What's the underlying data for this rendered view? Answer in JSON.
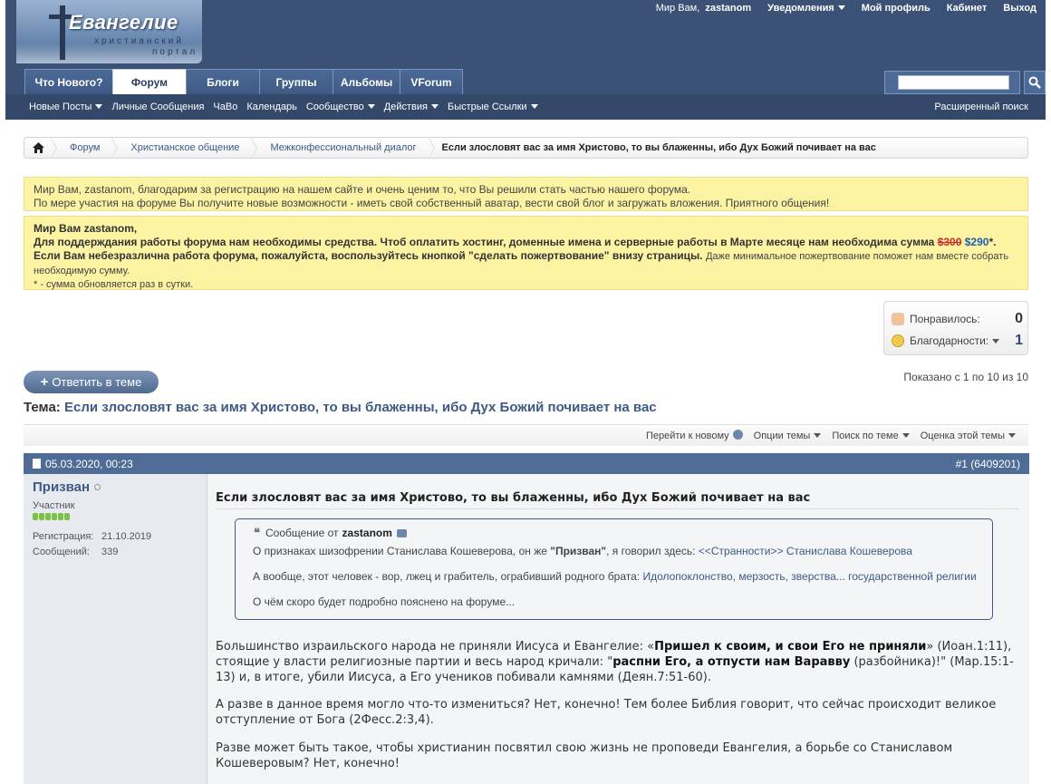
{
  "header": {
    "logo_title": "Евангелие",
    "logo_sub1": "христианский",
    "logo_sub2": "портал",
    "greeting": "Мир Вам,",
    "username": "zastanom",
    "notifications": "Уведомления",
    "my_profile": "Мой профиль",
    "cabinet": "Кабинет",
    "logout": "Выход"
  },
  "tabs": [
    {
      "label": "Что Нового?"
    },
    {
      "label": "Форум"
    },
    {
      "label": "Блоги"
    },
    {
      "label": "Группы"
    },
    {
      "label": "Альбомы"
    },
    {
      "label": "VForum"
    }
  ],
  "search": {
    "value": "",
    "placeholder": ""
  },
  "navbar": {
    "items": [
      {
        "label": "Новые Посты"
      },
      {
        "label": "Личные Сообщения"
      },
      {
        "label": "ЧаВо"
      },
      {
        "label": "Календарь"
      },
      {
        "label": "Сообщество"
      },
      {
        "label": "Действия"
      },
      {
        "label": "Быстрые Ссылки"
      }
    ],
    "advanced_search": "Расширенный поиск"
  },
  "breadcrumb": {
    "items": [
      "Форум",
      "Христианское общение",
      "Межконфессиональный диалог"
    ],
    "current": "Если злословят вас за имя Христово, то вы блаженны, ибо Дух Божий почивает на вас"
  },
  "notice1": {
    "line1": "Мир Вам, zastanom, благодарим за регистрацию на нашем сайте и очень ценим то, что Вы решили стать частью нашего форума.",
    "line2": "По мере участия на форуме Вы получите новые возможности - иметь свой собственный аватар, вести свой блог и загружать вложения. Приятного общения!"
  },
  "notice2": {
    "greeting": "Мир Вам zastanom,",
    "bold1": "Для поддерждания работы форума нам необходимы средства. Чтоб оплатить хостинг, доменные имена и серверные работы в Марте месяце нам необходима сумма",
    "old_sum": "$300",
    "new_sum": "$290",
    "bold2": "*. Если Вам небезразлична работа форума, пожалуйста, воспользуйтесь кнопкой \"сделать пожертвование\" внизу страницы.",
    "rest": "Даже минимальное пожертвование поможет нам вместе собрать необходимую сумму.",
    "footnote": "* - сумма обновляется раз в сутки."
  },
  "likes": {
    "liked_label": "Понравилось:",
    "liked_count": "0",
    "thanks_label": "Благодарности:",
    "thanks_count": "1"
  },
  "reply_button": "Ответить в теме",
  "shown_text": "Показано с 1 по 10 из 10",
  "thread": {
    "prefix": "Тема:",
    "title": "Если злословят вас за имя Христово, то вы блаженны, ибо Дух Божий почивает на вас"
  },
  "tools": {
    "goto_new": "Перейти к новому",
    "options": "Опции темы",
    "search": "Поиск по теме",
    "rate": "Оценка этой темы"
  },
  "post": {
    "date": "05.03.2020, 00:23",
    "number": "#1 (6409201)",
    "user": {
      "name": "Призван",
      "rank": "Участник",
      "reg_label": "Регистрация:",
      "reg_date": "21.10.2019",
      "posts_label": "Сообщений:",
      "posts_count": "339"
    },
    "title": "Если злословят вас за имя Христово, то вы блаженны, ибо Дух Божий почивает на вас",
    "quote": {
      "head": "Сообщение от",
      "author": "zastanom",
      "l1_pre": "О признаках шизофрении Станислава Кошеверова, он же ",
      "l1_bold": "\"Призван\"",
      "l1_mid": ", я говорил здесь: ",
      "l1_link": "<<Странности>> Станислава Кошеверова",
      "l2_pre": "А вообще, этот человек - вор, лжец и грабитель, ограбивший родного брата: ",
      "l2_link": "Идолопоклонство, мерзость, зверства... государственной религии",
      "l3": "О чём скоро будет подробно пояснено на форуме..."
    },
    "p1_a": "Большинство израильского народа не приняли Иисуса и Евангелие: «",
    "p1_b": "Пришел к своим, и свои Его не приняли",
    "p1_c": "» (Иоан.1:11), стоящие у власти религиозные партии и весь народ кричали: \"",
    "p1_d": "распни Его, а отпусти нам Варавву",
    "p1_e": " (разбойника)!\" (Мар.15:1-13) и, в итоге, убили Иисуса, а Его учеников побивали камнями (Деян.7:51-60).",
    "p2": "А разве в данное время могло что-то измениться? Нет, конечно! Тем более Библия говорит, что сейчас происходит великое отступление от Бога (2Фесс.2:3,4).",
    "p3": "Разве может быть такое, чтобы христианин посвятил свою жизнь не проповеди Евангелия, а борьбе со Станиславом Кошеверовым? Нет, конечно!"
  }
}
